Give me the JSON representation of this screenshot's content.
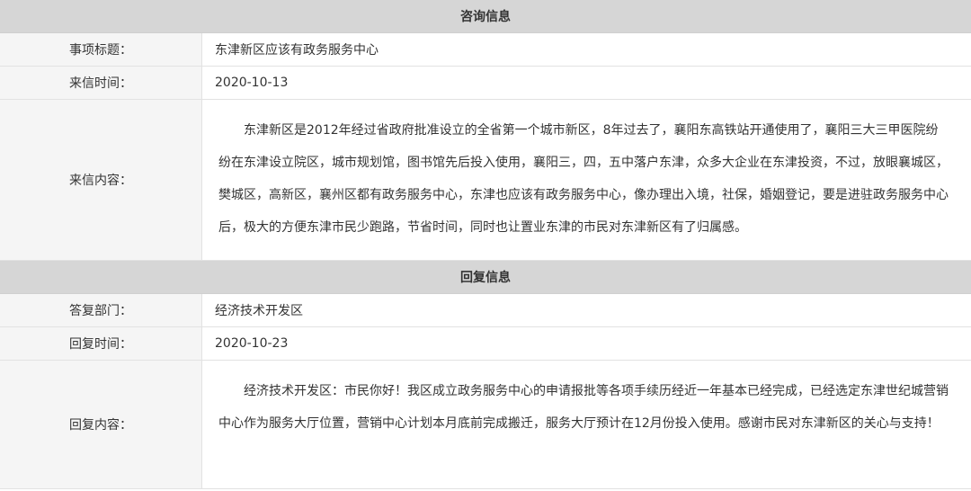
{
  "consult": {
    "header": "咨询信息",
    "subject_label": "事项标题：",
    "subject_value": "东津新区应该有政务服务中心",
    "date_label": "来信时间：",
    "date_value": "2020-10-13",
    "content_label": "来信内容：",
    "content_value": "东津新区是2012年经过省政府批准设立的全省第一个城市新区，8年过去了，襄阳东高铁站开通使用了，襄阳三大三甲医院纷纷在东津设立院区，城市规划馆，图书馆先后投入使用，襄阳三，四，五中落户东津，众多大企业在东津投资，不过，放眼襄城区，樊城区，高新区，襄州区都有政务服务中心，东津也应该有政务服务中心，像办理出入境，社保，婚姻登记，要是进驻政务服务中心后，极大的方便东津市民少跑路，节省时间，同时也让置业东津的市民对东津新区有了归属感。"
  },
  "reply": {
    "header": "回复信息",
    "dept_label": "答复部门：",
    "dept_value": "经济技术开发区",
    "date_label": "回复时间：",
    "date_value": "2020-10-23",
    "content_label": "回复内容：",
    "content_value": "经济技术开发区：市民你好！我区成立政务服务中心的申请报批等各项手续历经近一年基本已经完成，已经选定东津世纪城营销中心作为服务大厅位置，营销中心计划本月底前完成搬迁，服务大厅预计在12月份投入使用。感谢市民对东津新区的关心与支持！"
  }
}
